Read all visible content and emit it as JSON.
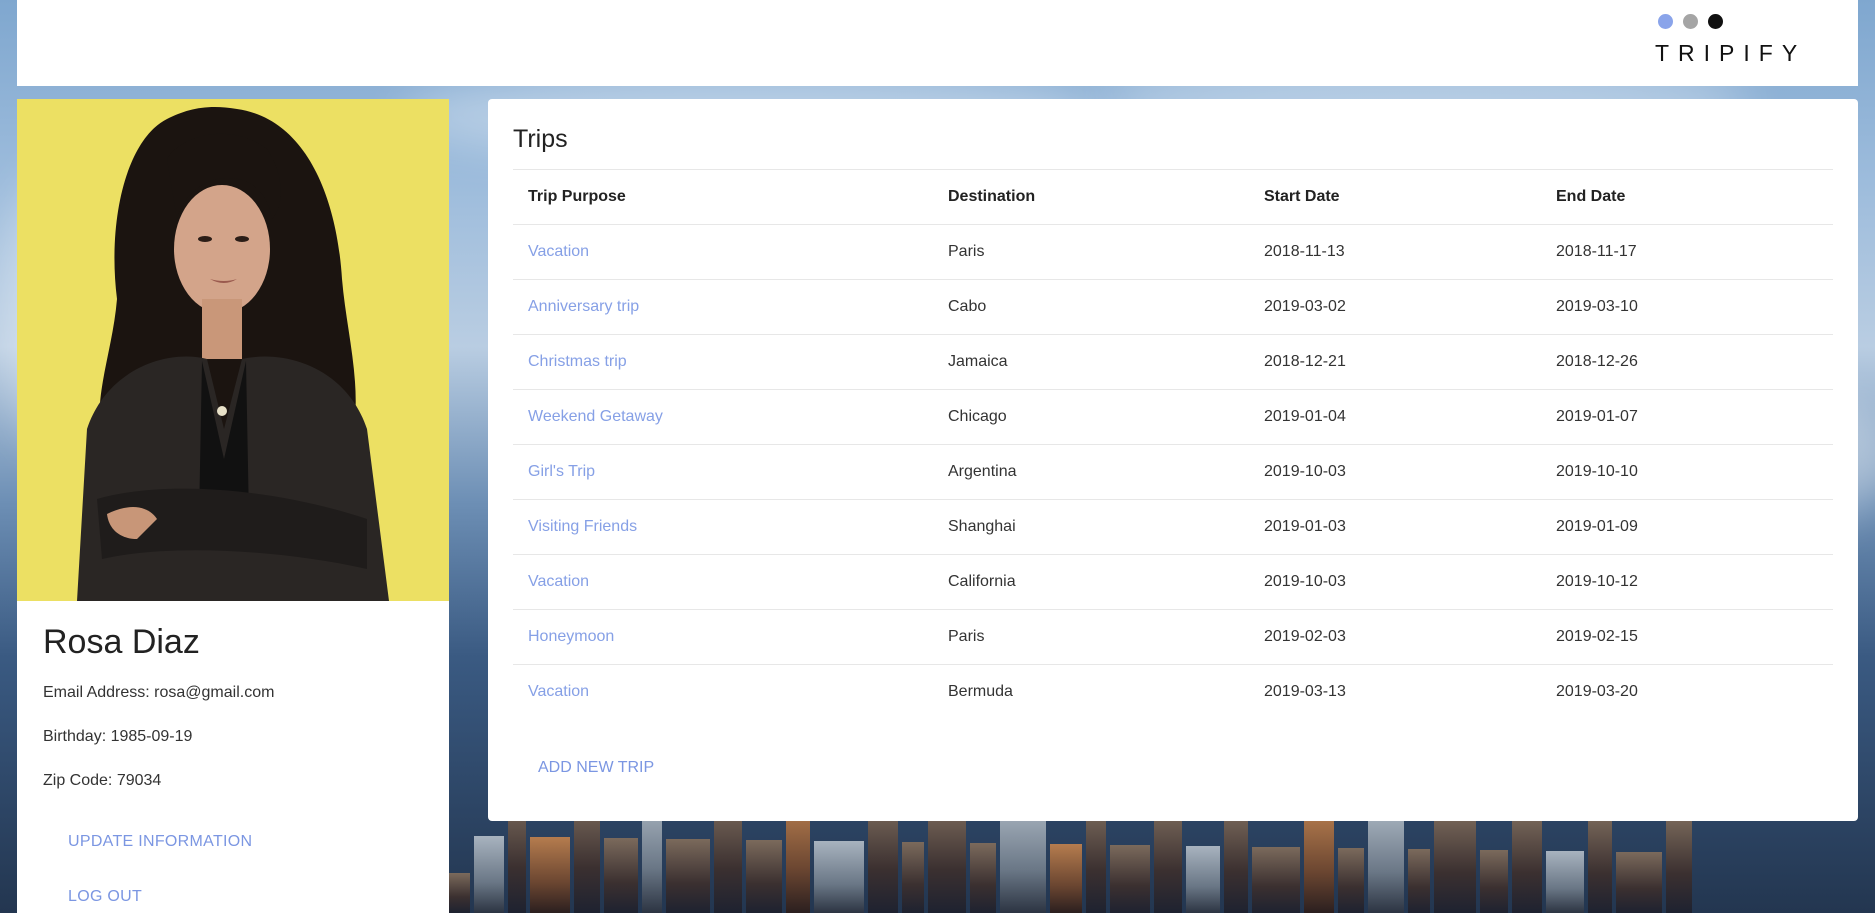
{
  "brand": {
    "name": "TRIPIFY",
    "dot_colors": [
      "#8aa4ea",
      "#a5a5a5",
      "#111111"
    ]
  },
  "profile": {
    "name": "Rosa Diaz",
    "email_line": "Email Address: rosa@gmail.com",
    "birthday_line": "Birthday: 1985-09-19",
    "zip_line": "Zip Code: 79034",
    "update_label": "Update Information",
    "logout_label": "Log Out"
  },
  "trips": {
    "title": "Trips",
    "columns": [
      "Trip Purpose",
      "Destination",
      "Start Date",
      "End Date"
    ],
    "rows": [
      {
        "purpose": "Vacation",
        "destination": "Paris",
        "start": "2018-11-13",
        "end": "2018-11-17"
      },
      {
        "purpose": "Anniversary trip",
        "destination": "Cabo",
        "start": "2019-03-02",
        "end": "2019-03-10"
      },
      {
        "purpose": "Christmas trip",
        "destination": "Jamaica",
        "start": "2018-12-21",
        "end": "2018-12-26"
      },
      {
        "purpose": "Weekend Getaway",
        "destination": "Chicago",
        "start": "2019-01-04",
        "end": "2019-01-07"
      },
      {
        "purpose": "Girl's Trip",
        "destination": "Argentina",
        "start": "2019-10-03",
        "end": "2019-10-10"
      },
      {
        "purpose": "Visiting Friends",
        "destination": "Shanghai",
        "start": "2019-01-03",
        "end": "2019-01-09"
      },
      {
        "purpose": "Vacation",
        "destination": "California",
        "start": "2019-10-03",
        "end": "2019-10-12"
      },
      {
        "purpose": "Honeymoon",
        "destination": "Paris",
        "start": "2019-02-03",
        "end": "2019-02-15"
      },
      {
        "purpose": "Vacation",
        "destination": "Bermuda",
        "start": "2019-03-13",
        "end": "2019-03-20"
      }
    ],
    "add_label": "Add New Trip"
  }
}
